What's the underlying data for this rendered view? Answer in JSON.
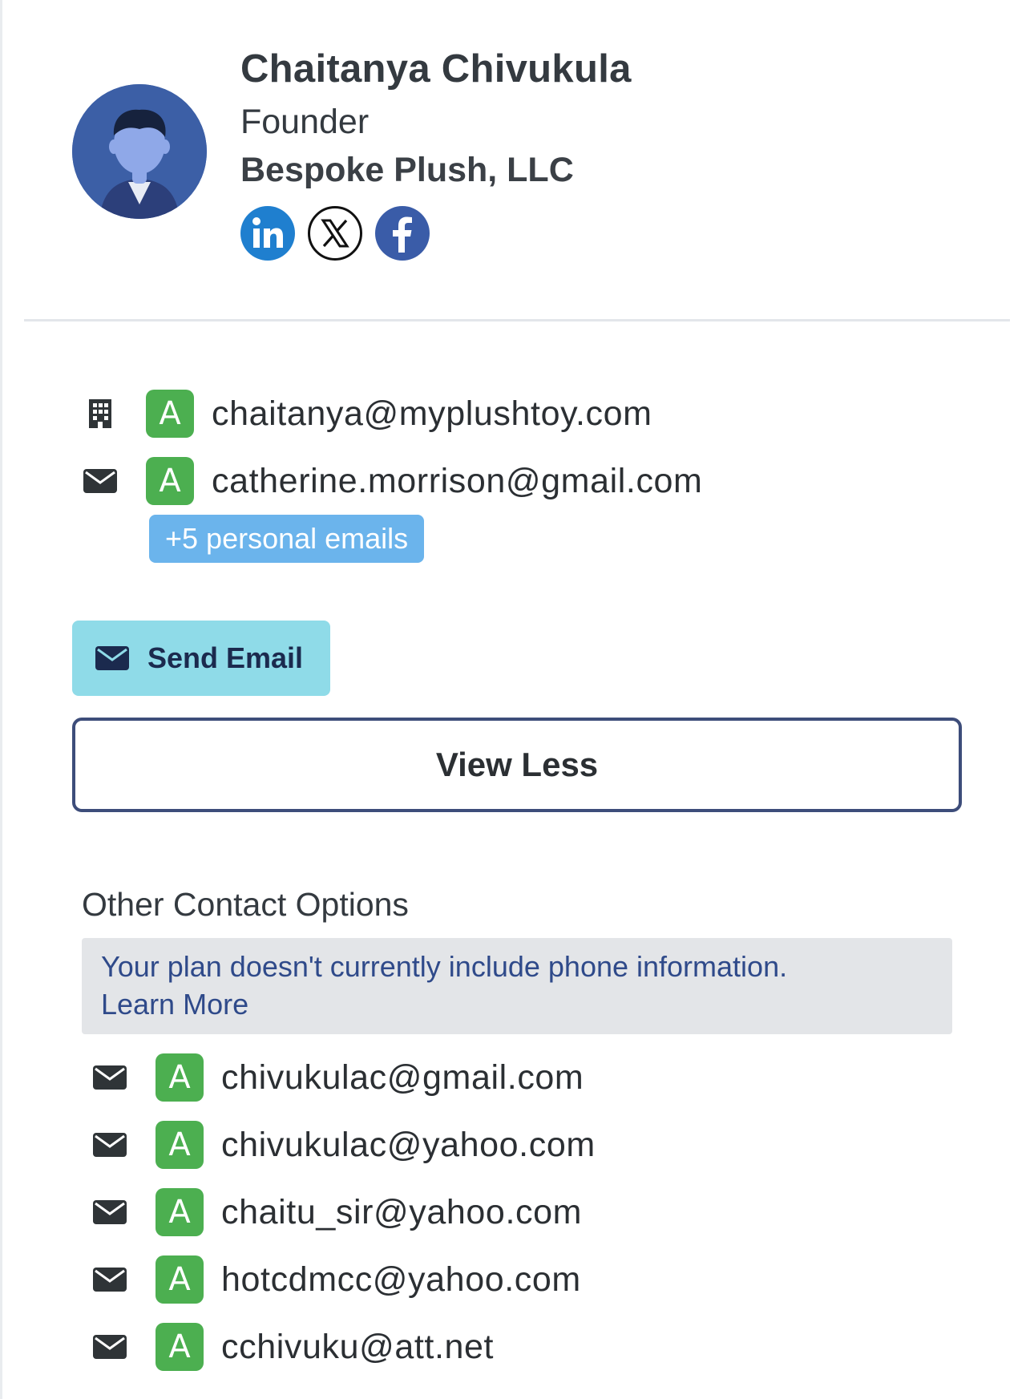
{
  "profile": {
    "name": "Chaitanya Chivukula",
    "title": "Founder",
    "company": "Bespoke Plush, LLC",
    "socials": [
      "linkedin-icon",
      "x-icon",
      "facebook-icon"
    ]
  },
  "primary_emails": [
    {
      "icon": "building-icon",
      "badge": "A",
      "email": "chaitanya@myplushtoy.com"
    },
    {
      "icon": "envelope-icon",
      "badge": "A",
      "email": "catherine.morrison@gmail.com"
    }
  ],
  "personal_emails_chip": "+5 personal emails",
  "actions": {
    "send_email": "Send Email",
    "view_less": "View Less"
  },
  "other_contact": {
    "title": "Other Contact Options",
    "notice": "Your plan doesn't currently include phone information.",
    "learn_more": "Learn More",
    "emails": [
      {
        "badge": "A",
        "email": "chivukulac@gmail.com"
      },
      {
        "badge": "A",
        "email": "chivukulac@yahoo.com"
      },
      {
        "badge": "A",
        "email": "chaitu_sir@yahoo.com"
      },
      {
        "badge": "A",
        "email": "hotcdmcc@yahoo.com"
      },
      {
        "badge": "A",
        "email": "cchivuku@att.net"
      }
    ]
  },
  "colors": {
    "badge_green": "#4caf50",
    "chip_blue": "#6bb4ec",
    "send_button": "#8fdbe8",
    "notice_text": "#2f4a8a"
  }
}
